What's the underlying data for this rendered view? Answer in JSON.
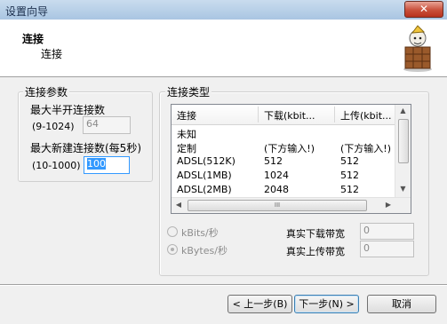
{
  "window": {
    "title": "设置向导",
    "close_label": "✕"
  },
  "header": {
    "title": "连接",
    "subtitle": "连接",
    "icon": "wizard-box-icon"
  },
  "params": {
    "group_label": "连接参数",
    "half_open_label": "最大半开连接数",
    "half_open_range": "(9-1024)",
    "half_open_value": "64",
    "new_conn_label": "最大新建连接数(每5秒)",
    "new_conn_range": "(10-1000)",
    "new_conn_value": "100"
  },
  "conn_type": {
    "group_label": "连接类型",
    "columns": [
      "连接",
      "下载(kbit...",
      "上传(kbit..."
    ],
    "rows": [
      [
        "未知",
        "",
        ""
      ],
      [
        "定制",
        "(下方输入!)",
        "(下方输入!)"
      ],
      [
        "ADSL(512K)",
        "512",
        "512"
      ],
      [
        "ADSL(1MB)",
        "1024",
        "512"
      ],
      [
        "ADSL(2MB)",
        "2048",
        "512"
      ]
    ],
    "hscroll_thumb": "III"
  },
  "units": {
    "kbits_label": "kBits/秒",
    "kbytes_label": "kBytes/秒",
    "selected": "kBytes/秒"
  },
  "bandwidth": {
    "download_label": "真实下载带宽",
    "download_value": "0",
    "upload_label": "真实上传带宽",
    "upload_value": "0"
  },
  "buttons": {
    "prev": "< 上一步(B)",
    "next": "下一步(N) >",
    "cancel": "取消"
  }
}
